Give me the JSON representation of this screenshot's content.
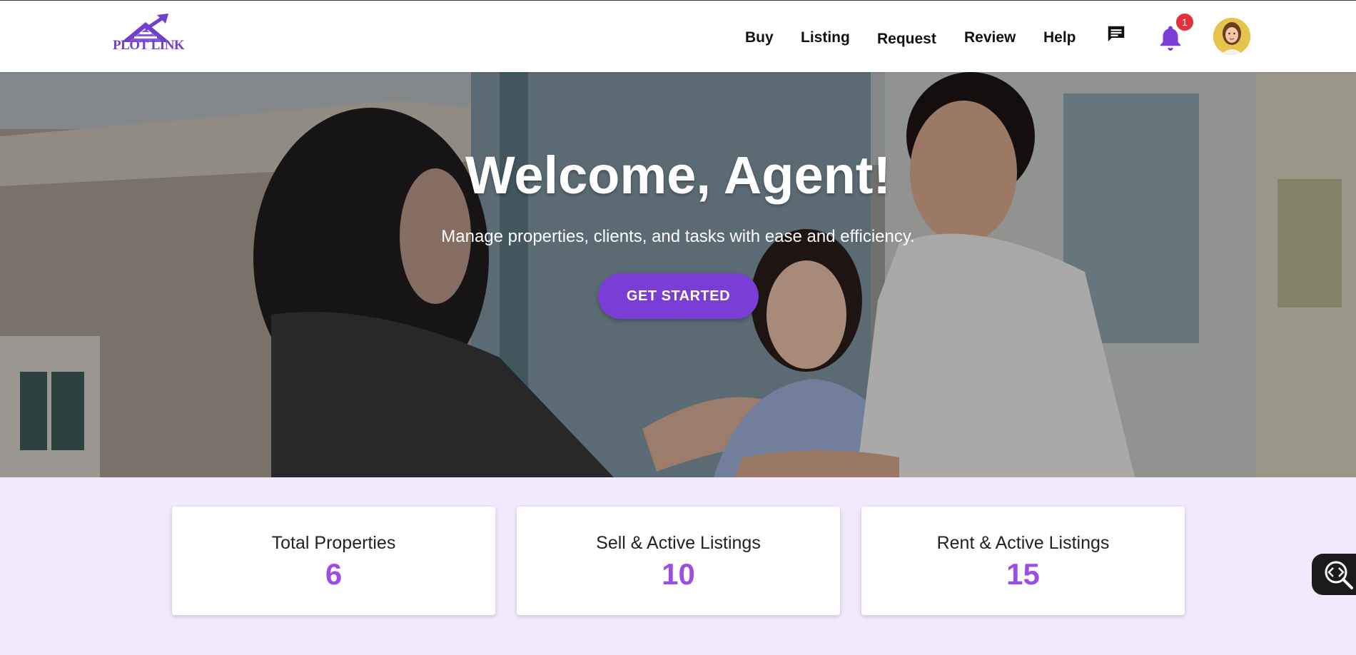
{
  "brand": {
    "logo_text": "PLOT LINK",
    "accent": "#7a3ed6"
  },
  "nav": {
    "links": [
      "Buy",
      "Listing",
      "Request",
      "Review",
      "Help"
    ],
    "notification_count": "1",
    "icons": {
      "messages": "chat-icon",
      "notifications": "bell-icon"
    }
  },
  "hero": {
    "title": "Welcome, Agent!",
    "subtitle": "Manage properties, clients, and tasks with ease and efficiency.",
    "cta_label": "GET STARTED"
  },
  "stats": [
    {
      "label": "Total Properties",
      "value": "6"
    },
    {
      "label": "Sell & Active Listings",
      "value": "10"
    },
    {
      "label": "Rent & Active Listings",
      "value": "15"
    }
  ],
  "colors": {
    "stat_value": "#9b4de6",
    "badge": "#e2323c",
    "stats_bg": "#f3e9ff"
  }
}
